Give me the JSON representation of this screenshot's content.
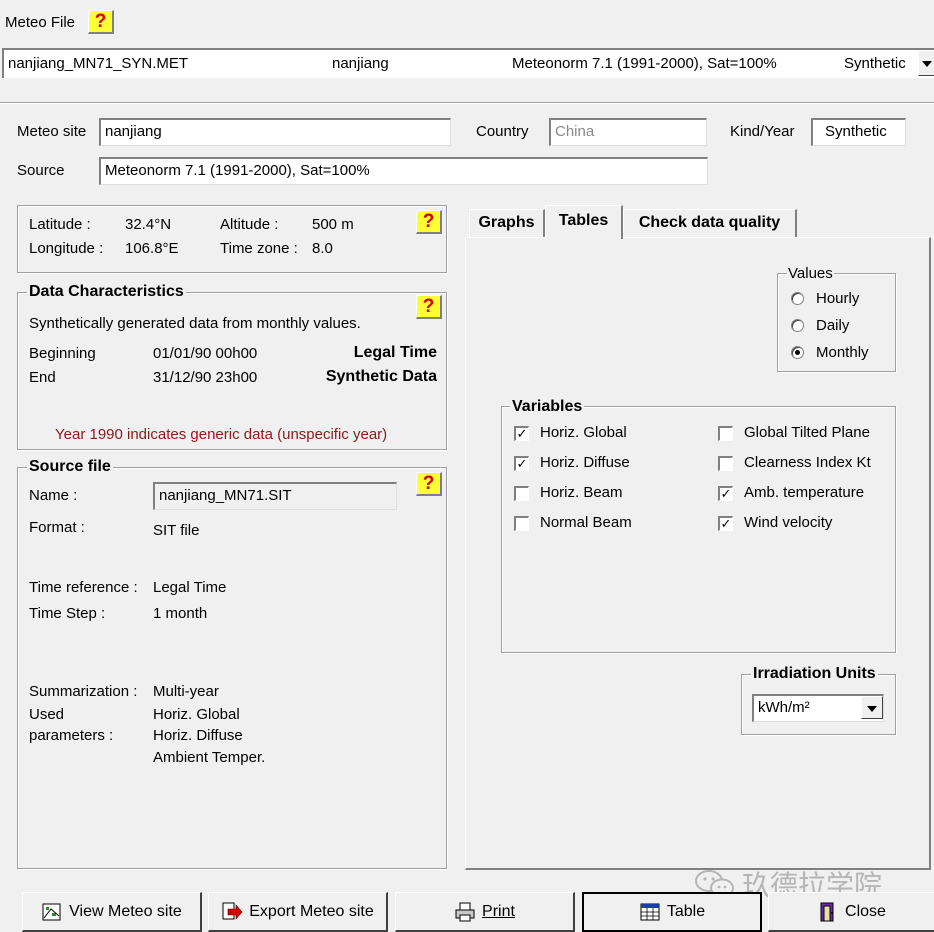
{
  "meteo_file": {
    "label": "Meteo File",
    "selected": {
      "file": "nanjiang_MN71_SYN.MET",
      "site": "nanjiang",
      "source": "Meteonorm 7.1 (1991-2000), Sat=100%",
      "kind": "Synthetic"
    }
  },
  "site": {
    "meteo_site_label": "Meteo site",
    "meteo_site_value": "nanjiang",
    "country_label": "Country",
    "country_value": "China",
    "kind_year_label": "Kind/Year",
    "kind_year_value": "Synthetic",
    "source_label": "Source",
    "source_value": "Meteonorm 7.1 (1991-2000), Sat=100%"
  },
  "location": {
    "latitude_label": "Latitude :",
    "latitude_value": "32.4°N",
    "longitude_label": "Longitude :",
    "longitude_value": "106.8°E",
    "altitude_label": "Altitude :",
    "altitude_value": "500 m",
    "timezone_label": "Time zone :",
    "timezone_value": "8.0"
  },
  "data_characteristics": {
    "title": "Data Characteristics",
    "description": "Synthetically generated data from monthly values.",
    "beginning_label": "Beginning",
    "beginning_value": "01/01/90 00h00",
    "beginning_note": "Legal Time",
    "end_label": "End",
    "end_value": "31/12/90 23h00",
    "end_note": "Synthetic Data",
    "warning": "Year 1990 indicates generic data (unspecific year)"
  },
  "source_file": {
    "title": "Source file",
    "name_label": "Name :",
    "name_value": "nanjiang_MN71.SIT",
    "format_label": "Format :",
    "format_value": "SIT file",
    "time_ref_label": "Time reference :",
    "time_ref_value": "Legal Time",
    "time_step_label": "Time Step :",
    "time_step_value": "1 month",
    "summarization_label": "Summarization :",
    "summarization_value": "Multi-year",
    "used_label_1": "Used",
    "used_label_2": "parameters :",
    "used_params": [
      "Horiz. Global",
      "Horiz. Diffuse",
      "Ambient Temper."
    ]
  },
  "tabs": [
    {
      "label": "Graphs",
      "active": false
    },
    {
      "label": "Tables",
      "active": true
    },
    {
      "label": "Check data quality",
      "active": false
    }
  ],
  "values_group": {
    "title": "Values",
    "options": [
      {
        "label": "Hourly",
        "selected": false
      },
      {
        "label": "Daily",
        "selected": false
      },
      {
        "label": "Monthly",
        "selected": true
      }
    ]
  },
  "variables_group": {
    "title": "Variables",
    "items": [
      {
        "label": "Horiz. Global",
        "checked": true
      },
      {
        "label": "Horiz. Diffuse",
        "checked": true
      },
      {
        "label": "Horiz. Beam",
        "checked": false
      },
      {
        "label": "Normal Beam",
        "checked": false
      },
      {
        "label": "Global Tilted Plane",
        "checked": false
      },
      {
        "label": "Clearness Index Kt",
        "checked": false
      },
      {
        "label": "Amb. temperature",
        "checked": true
      },
      {
        "label": "Wind velocity",
        "checked": true
      }
    ]
  },
  "irradiation_units": {
    "title": "Irradiation Units",
    "value": "kWh/m²"
  },
  "help_glyph": "?",
  "buttons": {
    "view_site": "View Meteo site",
    "export_site": "Export Meteo site",
    "print": "Print",
    "table": "Table",
    "close": "Close"
  },
  "watermark": "玖德拉学院",
  "colors": {
    "help_bg": "#ffff33",
    "help_fg": "#d40000",
    "warning": "#8b1a1a"
  }
}
